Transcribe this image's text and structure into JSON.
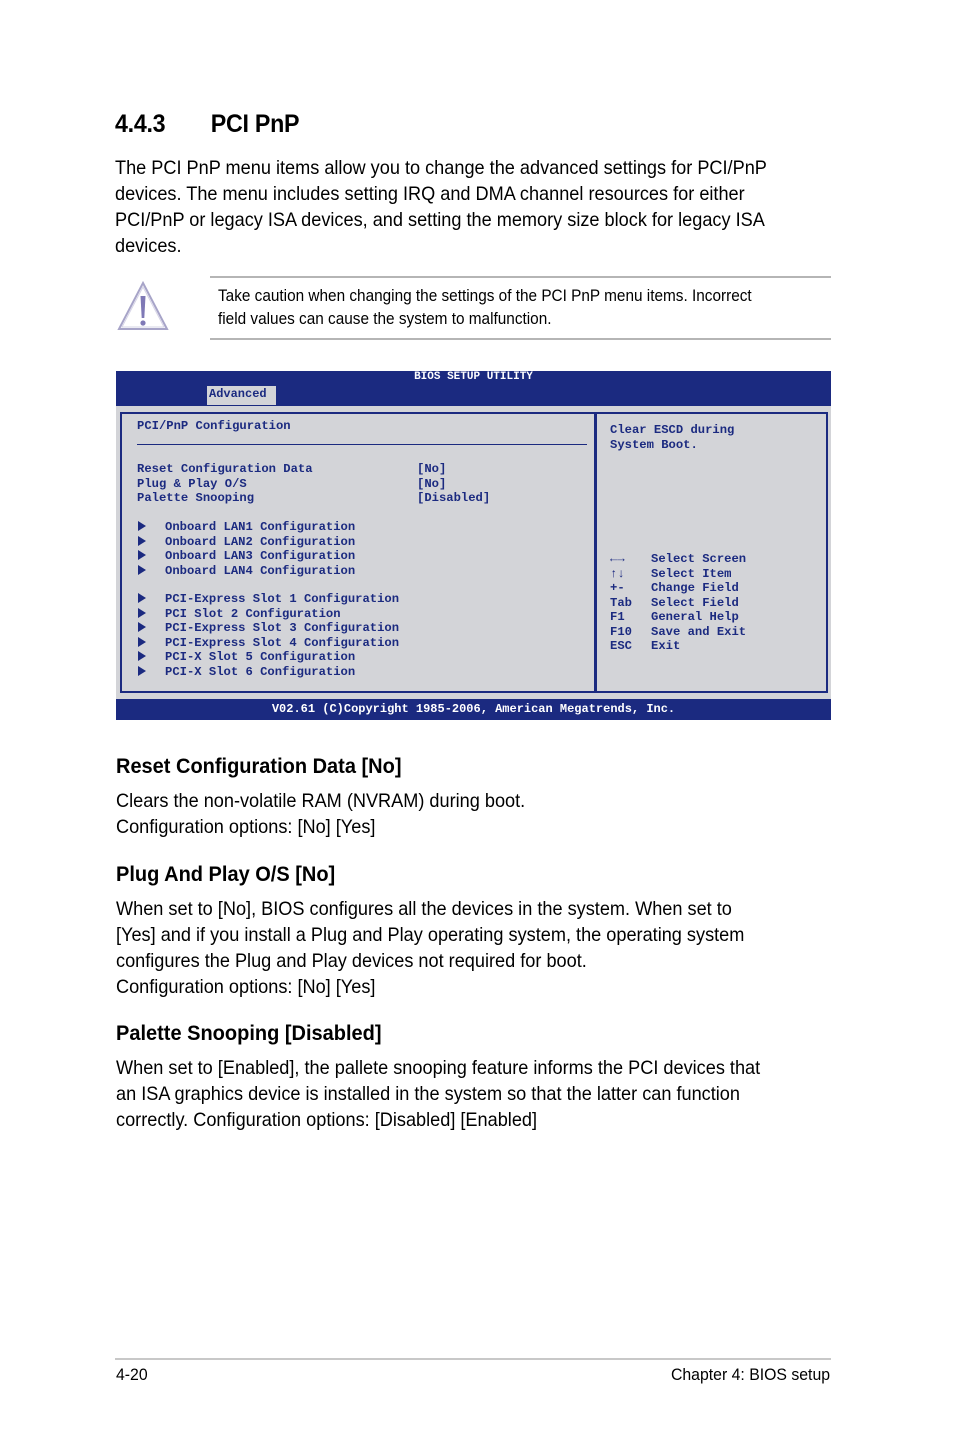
{
  "section": {
    "number": "4.4.3",
    "title": "PCI PnP",
    "intro_lines": [
      "The PCI PnP menu items allow you to change the advanced settings for PCI/PnP",
      "devices. The menu includes setting IRQ and DMA channel resources for either",
      "PCI/PnP or legacy ISA devices, and setting the memory size block for legacy ISA",
      "devices."
    ]
  },
  "caution": {
    "icon": "warning-triangle-icon",
    "lines": [
      "Take caution when changing the settings of the PCI PnP menu items. Incorrect",
      "field values can cause the system to malfunction."
    ]
  },
  "bios": {
    "title": "BIOS SETUP UTILITY",
    "active_tab": "Advanced",
    "panel_title": "PCI/PnP Configuration",
    "settings": [
      {
        "label": "Reset Configuration Data",
        "value": "[No]"
      },
      {
        "label": "Plug & Play O/S",
        "value": "[No]"
      },
      {
        "label": "Palette Snooping",
        "value": "[Disabled]"
      }
    ],
    "lan_submenus": [
      "Onboard LAN1 Configuration",
      "Onboard LAN2 Configuration",
      "Onboard LAN3 Configuration",
      "Onboard LAN4 Configuration"
    ],
    "slot_submenus": [
      "PCI-Express Slot 1 Configuration",
      "PCI Slot 2 Configuration",
      "PCI-Express Slot 3 Configuration",
      "PCI-Express Slot 4 Configuration",
      "PCI-X Slot 5 Configuration",
      "PCI-X Slot 6 Configuration"
    ],
    "help_lines": [
      "Clear ESCD during",
      "System Boot."
    ],
    "keys": [
      {
        "key": "←→",
        "action": "Select Screen"
      },
      {
        "key": "↑↓",
        "action": "Select Item"
      },
      {
        "key": "+-",
        "action": "Change Field"
      },
      {
        "key": "Tab",
        "action": "Select Field"
      },
      {
        "key": "F1",
        "action": "General Help"
      },
      {
        "key": "F10",
        "action": "Save and Exit"
      },
      {
        "key": "ESC",
        "action": "Exit"
      }
    ],
    "footer": "V02.61 (C)Copyright 1985-2006, American Megatrends, Inc.",
    "colors": {
      "background": "#1b2a80",
      "panel": "#d3d4d8",
      "text": "#1b2a80"
    }
  },
  "options": [
    {
      "heading": "Reset Configuration Data [No]",
      "lines": [
        "Clears the non-volatile RAM (NVRAM) during boot.",
        "Configuration options: [No] [Yes]"
      ]
    },
    {
      "heading": "Plug And Play O/S [No]",
      "lines": [
        "When set to [No], BIOS configures all the devices in the system. When set to",
        "[Yes] and if you install a Plug and Play operating system, the operating system",
        "configures the Plug and Play devices not required for boot.",
        "Configuration options: [No] [Yes]"
      ]
    },
    {
      "heading": "Palette Snooping [Disabled]",
      "lines": [
        "When set to [Enabled], the pallete snooping feature informs the PCI devices that",
        "an ISA graphics device is installed in the system so that the latter can function",
        "correctly. Configuration options: [Disabled] [Enabled]"
      ]
    }
  ],
  "footer": {
    "page_number": "4-20",
    "chapter": "Chapter 4: BIOS setup"
  }
}
